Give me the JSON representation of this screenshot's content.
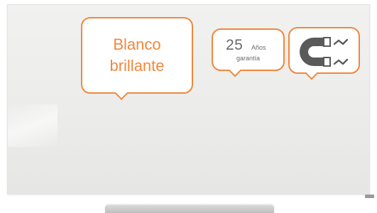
{
  "badges": {
    "finish": {
      "line1": "Blanco",
      "line2": "brillante"
    },
    "warranty": {
      "number": "25",
      "unit": "Años",
      "label": "garantía"
    },
    "magnetic": {
      "icon": "magnet-icon"
    }
  },
  "colors": {
    "accent": "#f0883e",
    "text_gray": "#6a6a6a",
    "magnet_gray": "#5a5a5a"
  }
}
